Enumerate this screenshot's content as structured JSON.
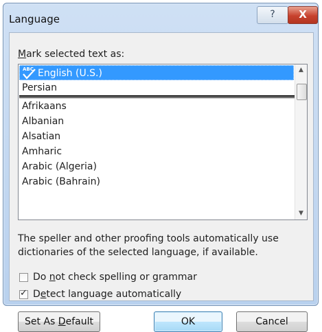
{
  "window": {
    "title": "Language",
    "help_glyph": "?",
    "close_glyph": "X"
  },
  "mark_label": {
    "mnemonic": "M",
    "rest": "ark selected text as:"
  },
  "list": {
    "selected": "English (U.S.)",
    "recent": [
      "Persian"
    ],
    "items": [
      "Afrikaans",
      "Albanian",
      "Alsatian",
      "Amharic",
      "Arabic (Algeria)",
      "Arabic (Bahrain)"
    ]
  },
  "description": "The speller and other proofing tools automatically use dictionaries of the selected language, if available.",
  "options": {
    "no_check": {
      "pre": "Do ",
      "mnemonic": "n",
      "post": "ot check spelling or grammar",
      "checked": false
    },
    "detect": {
      "pre": "D",
      "mnemonic": "e",
      "post": "tect language automatically",
      "checked": true
    }
  },
  "buttons": {
    "set_default": {
      "pre": "Set As ",
      "mnemonic": "D",
      "post": "efault"
    },
    "ok": "OK",
    "cancel": "Cancel"
  },
  "icons": {
    "spellcheck": "spellcheck-icon",
    "help": "help-icon",
    "close": "close-icon"
  },
  "colors": {
    "selection": "#3399ff",
    "dialog_bg": "#f0f0f0",
    "close_button": "#c7412d"
  }
}
